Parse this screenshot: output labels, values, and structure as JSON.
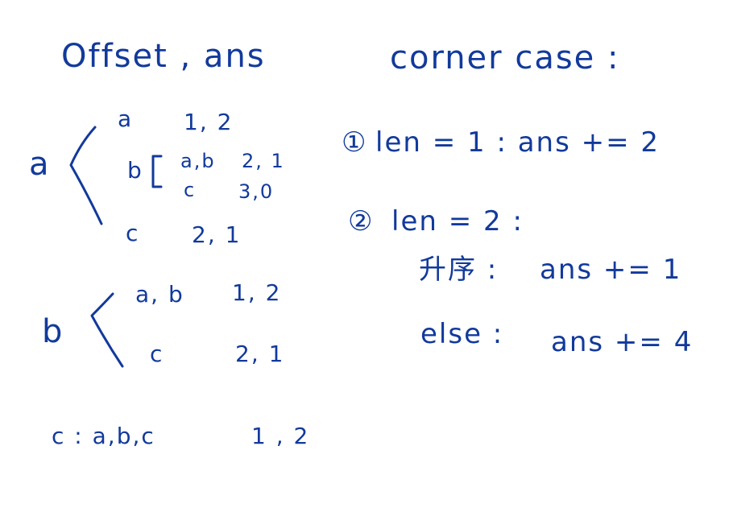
{
  "header": {
    "left_title": "Offset , ans",
    "right_title": "corner case :"
  },
  "group_a": {
    "label": "a",
    "rows": [
      {
        "key": "a",
        "value": "1, 2"
      },
      {
        "key": "b",
        "value": ""
      },
      {
        "key": "c",
        "value": "2, 1"
      }
    ],
    "sub_b": [
      {
        "key": "a,b",
        "value": "2, 1"
      },
      {
        "key": "c",
        "value": "3,0"
      }
    ]
  },
  "group_b": {
    "label": "b",
    "rows": [
      {
        "key": "a, b",
        "value": "1, 2"
      },
      {
        "key": "c",
        "value": "2, 1"
      }
    ]
  },
  "group_c": {
    "line": "c : a,b,c",
    "value": "1 , 2"
  },
  "corner_cases": {
    "case1": {
      "marker": "①",
      "text": "len = 1 :  ans += 2"
    },
    "case2": {
      "marker": "②",
      "text": "len = 2 :"
    },
    "case2_sub1": {
      "label": "升序 :",
      "result": "ans += 1"
    },
    "case2_sub2": {
      "label": "else :",
      "result": "ans += 4"
    }
  }
}
